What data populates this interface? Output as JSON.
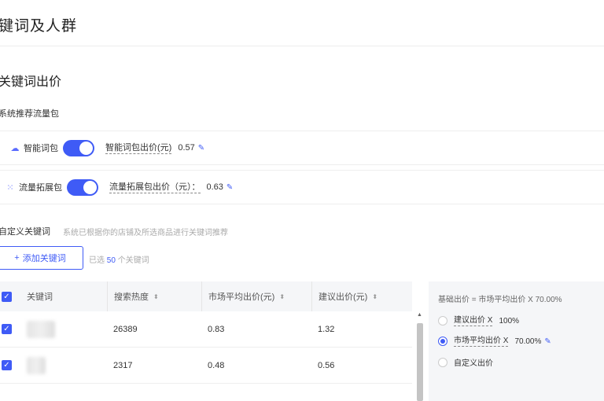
{
  "header": {
    "title": "键词及人群"
  },
  "bid_section": {
    "title": "关键词出价",
    "package_title": "系统推荐流量包",
    "packages": [
      {
        "icon": "cloud-icon",
        "name": "智能词包",
        "enabled": true,
        "price_label": "智能词包出价(元)",
        "price": "0.57"
      },
      {
        "icon": "expand-icon",
        "name": "流量拓展包",
        "enabled": true,
        "price_label": "流量拓展包出价（元）：",
        "price": "0.63"
      }
    ]
  },
  "custom_keywords": {
    "title": "自定义关键词",
    "hint": "系统已根据你的店铺及所选商品进行关键词推荐",
    "add_button": "添加关键词",
    "selected_prefix": "已选",
    "selected_count": "50",
    "selected_suffix": "个关键词"
  },
  "table": {
    "headers": [
      "关键词",
      "搜索热度",
      "市场平均出价(元)",
      "建议出价(元)"
    ],
    "rows": [
      {
        "checked": true,
        "keyword": "",
        "heat": "26389",
        "avg_price": "0.83",
        "suggest_price": "1.32"
      },
      {
        "checked": true,
        "keyword": "",
        "heat": "2317",
        "avg_price": "0.48",
        "suggest_price": "0.56"
      }
    ]
  },
  "bid_panel": {
    "formula": "基础出价 = 市场平均出价 X 70.00%",
    "options": [
      {
        "label": "建议出价 X",
        "value": "100%",
        "checked": false
      },
      {
        "label": "市场平均出价 X",
        "value": "70.00%",
        "checked": true
      },
      {
        "label": "自定义出价",
        "value": "",
        "checked": false
      }
    ]
  },
  "colors": {
    "accent": "#3f5bf6",
    "panel_bg": "#f5f6f8"
  }
}
